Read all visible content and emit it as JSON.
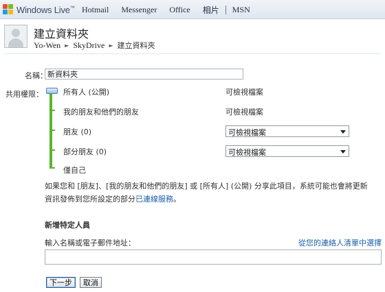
{
  "header": {
    "brand": "Windows Live",
    "brand_tm": "™",
    "nav": [
      "Hotmail",
      "Messenger",
      "Office",
      "相片",
      "MSN"
    ]
  },
  "page": {
    "title": "建立資料夾",
    "breadcrumb": [
      "Yo-Wen",
      "SkyDrive",
      "建立資料夾"
    ]
  },
  "form": {
    "name_label": "名稱：",
    "name_value": "新資料夾",
    "permission_label": "共用權限：",
    "levels": [
      {
        "label": "所有人 (公開)",
        "value": "可檢視檔案",
        "type": "text"
      },
      {
        "label": "我的朋友和他們的朋友",
        "value": "可檢視檔案",
        "type": "text"
      },
      {
        "label": "朋友 (0)",
        "value": "可檢視檔案",
        "type": "select"
      },
      {
        "label": "部分朋友 (0)",
        "value": "可檢視檔案",
        "type": "select"
      },
      {
        "label": "僅自己",
        "value": "",
        "type": "none"
      }
    ],
    "selected_level": "所有人 (公開)",
    "note_text": "如果您和 [朋友]、[我的朋友和他們的朋友] 或 [所有人] (公開) 分享此項目，系統可能也會將更新資訊發佈到您所設定的部分",
    "note_link": "已連線服務",
    "note_end": "。"
  },
  "people": {
    "section_title": "新增特定人員",
    "input_label": "輸入名稱或電子郵件地址：",
    "contacts_link": "從您的連絡人清單中選擇",
    "input_value": ""
  },
  "buttons": {
    "next": "下一步",
    "cancel": "取消"
  },
  "colors": {
    "link": "#1a5fa8",
    "track": "#58b52c",
    "header_bg": "#dfe6ee"
  }
}
